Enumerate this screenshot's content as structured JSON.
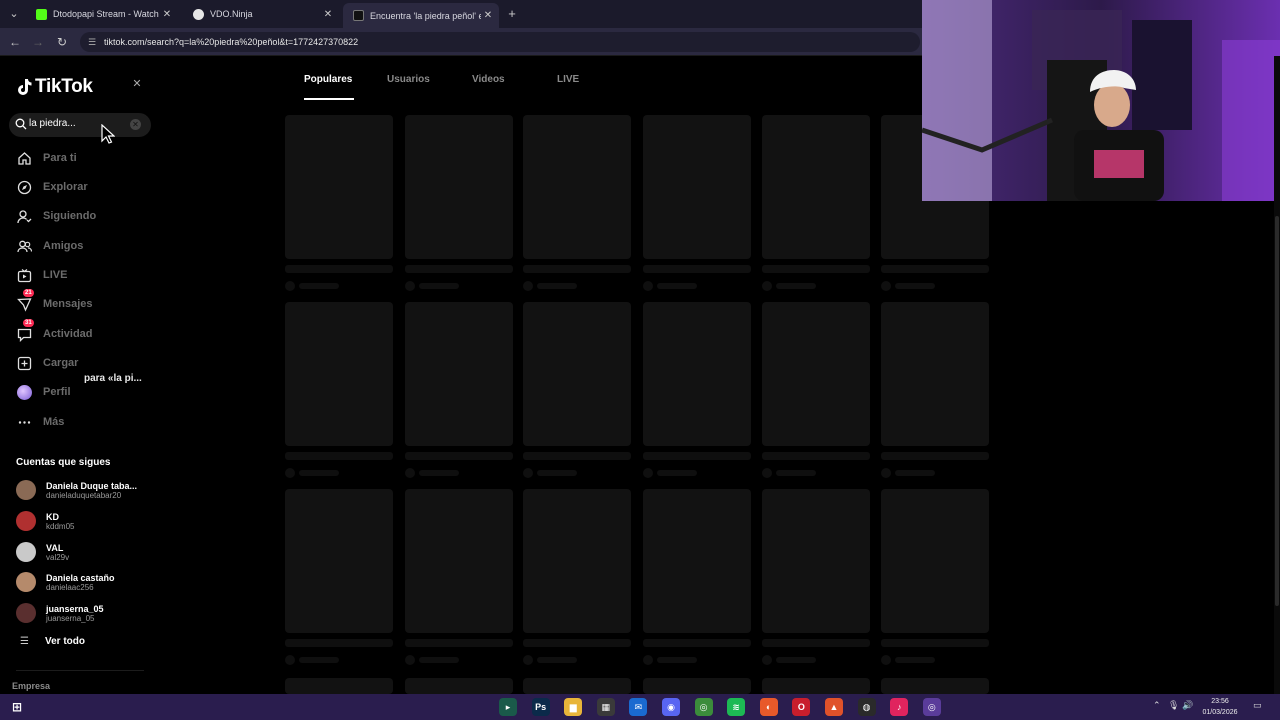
{
  "browser": {
    "tabs": [
      {
        "title": "Dtodopapi Stream - Watch Live",
        "favicon_color": "#53fc18"
      },
      {
        "title": "VDO.Ninja",
        "favicon_color": "#e6e6e6"
      },
      {
        "title": "Encuentra 'la piedra peñol' en TikTok",
        "favicon_color": "#111111"
      }
    ],
    "active_tab": 2,
    "url": "tiktok.com/search?q=la%20piedra%20peñol&t=1772427370822"
  },
  "sidebar": {
    "logo_text": "TikTok",
    "search_value": "la piedra...",
    "nav": [
      {
        "label": "Para ti",
        "icon": "home-icon"
      },
      {
        "label": "Explorar",
        "icon": "compass-icon"
      },
      {
        "label": "Siguiendo",
        "icon": "following-icon"
      },
      {
        "label": "Amigos",
        "icon": "friends-icon"
      },
      {
        "label": "LIVE",
        "icon": "live-icon"
      },
      {
        "label": "Mensajes",
        "icon": "messages-icon",
        "badge": "21"
      },
      {
        "label": "Actividad",
        "icon": "activity-icon",
        "badge": "31"
      },
      {
        "label": "Cargar",
        "icon": "upload-icon"
      },
      {
        "label": "Perfil",
        "icon": "profile-icon"
      },
      {
        "label": "Más",
        "icon": "more-icon"
      }
    ],
    "tooltip": "para «la pi...",
    "following_title": "Cuentas que sigues",
    "accounts": [
      {
        "name": "Daniela Duque taba...",
        "username": "danieladuquetabar20",
        "avatar_color": "#8a6a55"
      },
      {
        "name": "KD",
        "username": "kddm05",
        "avatar_color": "#b03030"
      },
      {
        "name": "VAL",
        "username": "val29v",
        "avatar_color": "#c9c9c9"
      },
      {
        "name": "Daniela castaño",
        "username": "danielaac256",
        "avatar_color": "#b58a6b"
      },
      {
        "name": "juanserna_05",
        "username": "juanserna_05",
        "avatar_color": "#5a2f2f"
      }
    ],
    "see_all": "Ver todo",
    "footer": "Empresa"
  },
  "main": {
    "tabs": [
      "Populares",
      "Usuarios",
      "Videos",
      "LIVE"
    ],
    "active_tab": 0
  },
  "taskbar": {
    "time": "23:56",
    "date": "01/03/2026",
    "apps": [
      "terminal-icon",
      "photoshop-icon",
      "folder-icon",
      "calculator-icon",
      "mail-icon",
      "discord-icon",
      "chrome-icon",
      "spotify-icon",
      "firefox-icon",
      "opera-icon",
      "brave-icon",
      "obs-icon",
      "tiktok-icon",
      "chrome-alt-icon"
    ]
  }
}
